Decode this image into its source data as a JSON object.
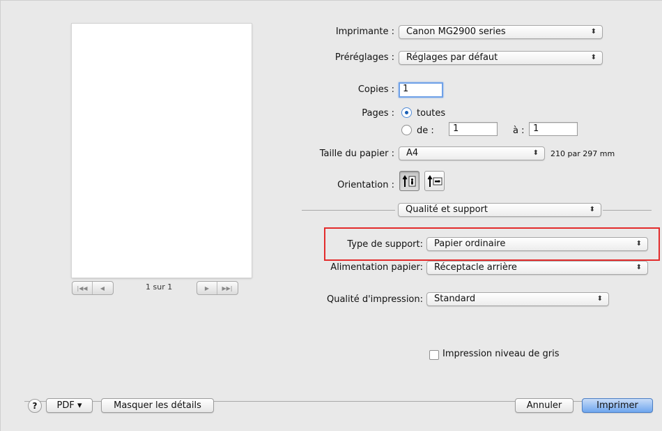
{
  "printer": {
    "label": "Imprimante :",
    "value": "Canon MG2900 series"
  },
  "presets": {
    "label": "Préréglages :",
    "value": "Réglages par défaut"
  },
  "copies": {
    "label": "Copies :",
    "value": "1"
  },
  "pages": {
    "label": "Pages :",
    "all_label": "toutes",
    "from_label": "de :",
    "from_value": "1",
    "to_label": "à :",
    "to_value": "1",
    "selected": "all"
  },
  "paper_size": {
    "label": "Taille du papier :",
    "value": "A4",
    "dimensions": "210 par 297 mm"
  },
  "orientation": {
    "label": "Orientation :",
    "selected": "portrait"
  },
  "section_popup": {
    "value": "Qualité et support"
  },
  "media_type": {
    "label": "Type de support:",
    "value": "Papier ordinaire"
  },
  "paper_source": {
    "label": "Alimentation papier:",
    "value": "Réceptacle arrière"
  },
  "print_quality": {
    "label": "Qualité d'impression:",
    "value": "Standard"
  },
  "grayscale": {
    "label": "Impression niveau de gris",
    "checked": false
  },
  "preview": {
    "page_indicator": "1 sur 1"
  },
  "footer": {
    "help": "?",
    "pdf": "PDF ▾",
    "hide_details": "Masquer les détails",
    "cancel": "Annuler",
    "print": "Imprimer"
  },
  "colors": {
    "highlight": "#e32b2b",
    "primary_button": "#6fa6ee"
  },
  "arrows_glyph": "⬍"
}
